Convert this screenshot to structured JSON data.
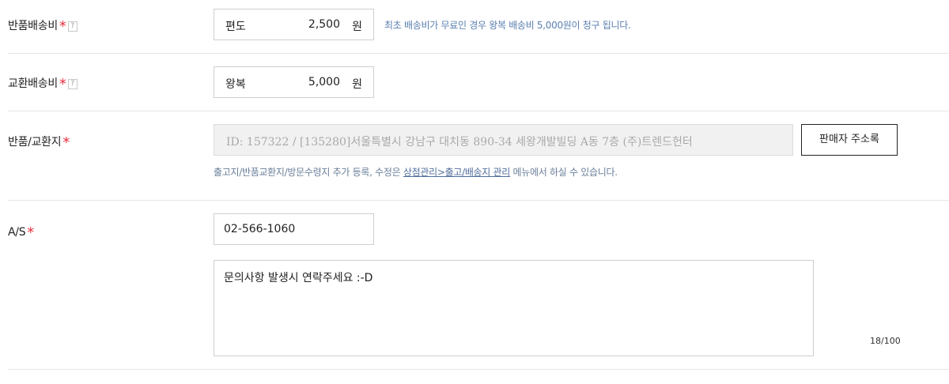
{
  "return_shipping": {
    "label": "반품배송비",
    "required_mark": "*",
    "help": "?",
    "type": "편도",
    "amount": "2,500",
    "unit": "원",
    "note": "최초 배송비가 무료인 경우 왕복 배송비 5,000원이 청구 됩니다."
  },
  "exchange_shipping": {
    "label": "교환배송비",
    "required_mark": "*",
    "help": "?",
    "type": "왕복",
    "amount": "5,000",
    "unit": "원"
  },
  "return_address": {
    "label": "반품/교환지",
    "required_mark": "*",
    "address": "ID: 157322 / [135280]서울특별시 강남구 대치동 890-34 세왕개발빌딩 A동 7층 (주)트렌드헌터",
    "button": "판매자 주소록",
    "help_prefix": "출고지/반품교환지/방문수령지 추가 등록, 수정은 ",
    "help_link": "상점관리>출고/배송지 관리",
    "help_suffix": " 메뉴에서 하실 수 있습니다."
  },
  "as": {
    "label": "A/S",
    "required_mark": "*",
    "phone": "02-566-1060",
    "message": "문의사항 발생시 연락주세요 :-D",
    "counter": "18/100"
  },
  "colors": {
    "required": "#e8303e",
    "note": "#5a7fb0",
    "border": "#cfcfcf"
  }
}
